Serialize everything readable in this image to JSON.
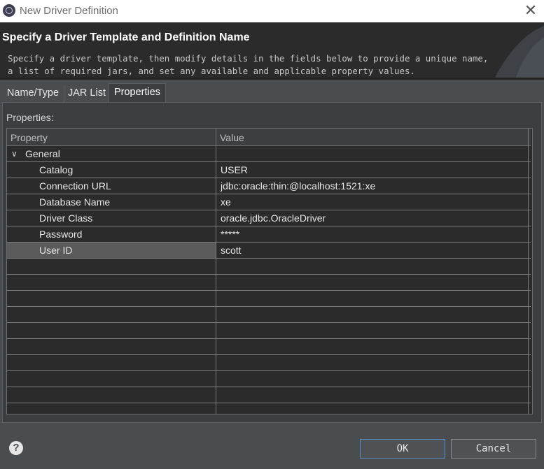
{
  "window": {
    "title": "New Driver Definition",
    "close_icon": "close-icon"
  },
  "header": {
    "title": "Specify a Driver Template and Definition Name",
    "description": "Specify a driver template, then modify details in the fields below to provide a unique name, a list of required jars, and set any available and applicable property values."
  },
  "tabs": [
    {
      "label": "Name/Type"
    },
    {
      "label": "JAR List"
    },
    {
      "label": "Properties",
      "active": true
    }
  ],
  "properties": {
    "label": "Properties:",
    "columns": {
      "property": "Property",
      "value": "Value"
    },
    "group": {
      "label": "General",
      "expanded": true
    },
    "rows": [
      {
        "name": "Catalog",
        "value": "USER"
      },
      {
        "name": "Connection URL",
        "value": "jdbc:oracle:thin:@localhost:1521:xe"
      },
      {
        "name": "Database Name",
        "value": "xe"
      },
      {
        "name": "Driver Class",
        "value": "oracle.jdbc.OracleDriver"
      },
      {
        "name": "Password",
        "value": "*****"
      },
      {
        "name": "User ID",
        "value": "scott",
        "selected": true
      }
    ]
  },
  "footer": {
    "help_label": "?",
    "ok_label": "OK",
    "cancel_label": "Cancel"
  },
  "colors": {
    "accent": "#5a8fc4",
    "background": "#3c3f41",
    "header": "#2b2b2b"
  }
}
